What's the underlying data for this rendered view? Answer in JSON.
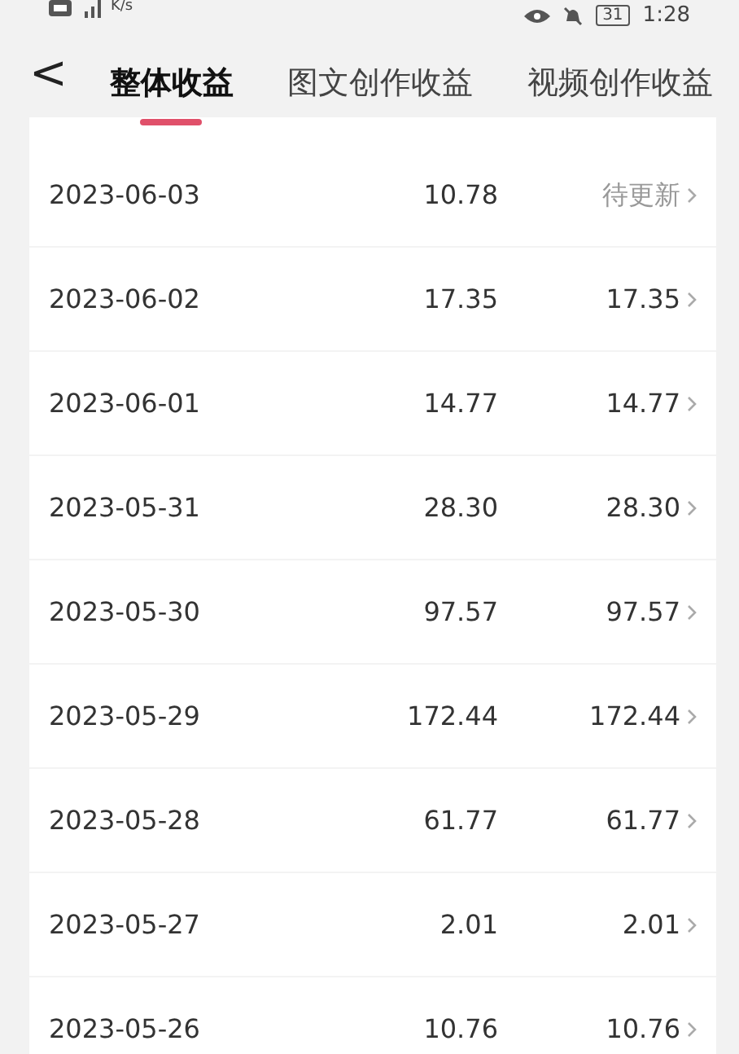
{
  "status_bar": {
    "speed_unit": "K/s",
    "battery": "31",
    "time": "1:28"
  },
  "header": {
    "back": "<",
    "tabs": [
      {
        "label": "整体收益",
        "selected": true
      },
      {
        "label": "图文创作收益",
        "selected": false
      },
      {
        "label": "视频创作收益",
        "selected": false
      }
    ]
  },
  "rows": [
    {
      "date": "2023-06-03",
      "amount": "10.78",
      "settled": "待更新",
      "pending": true
    },
    {
      "date": "2023-06-02",
      "amount": "17.35",
      "settled": "17.35",
      "pending": false
    },
    {
      "date": "2023-06-01",
      "amount": "14.77",
      "settled": "14.77",
      "pending": false
    },
    {
      "date": "2023-05-31",
      "amount": "28.30",
      "settled": "28.30",
      "pending": false
    },
    {
      "date": "2023-05-30",
      "amount": "97.57",
      "settled": "97.57",
      "pending": false
    },
    {
      "date": "2023-05-29",
      "amount": "172.44",
      "settled": "172.44",
      "pending": false
    },
    {
      "date": "2023-05-28",
      "amount": "61.77",
      "settled": "61.77",
      "pending": false
    },
    {
      "date": "2023-05-27",
      "amount": "2.01",
      "settled": "2.01",
      "pending": false
    },
    {
      "date": "2023-05-26",
      "amount": "10.76",
      "settled": "10.76",
      "pending": false
    }
  ]
}
